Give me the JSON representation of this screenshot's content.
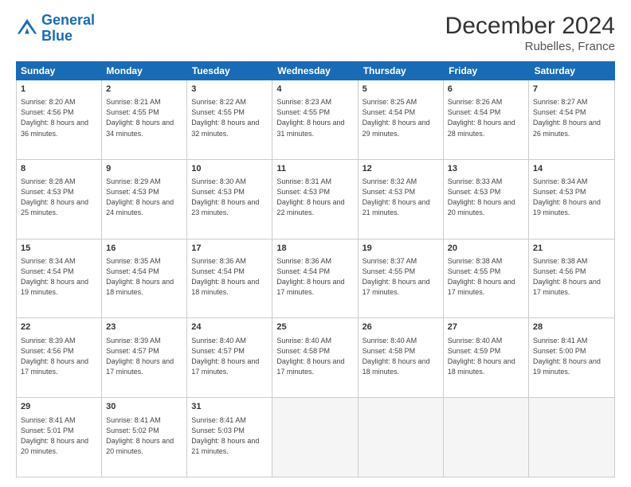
{
  "logo": {
    "line1": "General",
    "line2": "Blue"
  },
  "title": "December 2024",
  "subtitle": "Rubelles, France",
  "days": [
    "Sunday",
    "Monday",
    "Tuesday",
    "Wednesday",
    "Thursday",
    "Friday",
    "Saturday"
  ],
  "weeks": [
    [
      {
        "num": "1",
        "sunrise": "8:20 AM",
        "sunset": "4:56 PM",
        "daylight": "8 hours and 36 minutes."
      },
      {
        "num": "2",
        "sunrise": "8:21 AM",
        "sunset": "4:55 PM",
        "daylight": "8 hours and 34 minutes."
      },
      {
        "num": "3",
        "sunrise": "8:22 AM",
        "sunset": "4:55 PM",
        "daylight": "8 hours and 32 minutes."
      },
      {
        "num": "4",
        "sunrise": "8:23 AM",
        "sunset": "4:55 PM",
        "daylight": "8 hours and 31 minutes."
      },
      {
        "num": "5",
        "sunrise": "8:25 AM",
        "sunset": "4:54 PM",
        "daylight": "8 hours and 29 minutes."
      },
      {
        "num": "6",
        "sunrise": "8:26 AM",
        "sunset": "4:54 PM",
        "daylight": "8 hours and 28 minutes."
      },
      {
        "num": "7",
        "sunrise": "8:27 AM",
        "sunset": "4:54 PM",
        "daylight": "8 hours and 26 minutes."
      }
    ],
    [
      {
        "num": "8",
        "sunrise": "8:28 AM",
        "sunset": "4:53 PM",
        "daylight": "8 hours and 25 minutes."
      },
      {
        "num": "9",
        "sunrise": "8:29 AM",
        "sunset": "4:53 PM",
        "daylight": "8 hours and 24 minutes."
      },
      {
        "num": "10",
        "sunrise": "8:30 AM",
        "sunset": "4:53 PM",
        "daylight": "8 hours and 23 minutes."
      },
      {
        "num": "11",
        "sunrise": "8:31 AM",
        "sunset": "4:53 PM",
        "daylight": "8 hours and 22 minutes."
      },
      {
        "num": "12",
        "sunrise": "8:32 AM",
        "sunset": "4:53 PM",
        "daylight": "8 hours and 21 minutes."
      },
      {
        "num": "13",
        "sunrise": "8:33 AM",
        "sunset": "4:53 PM",
        "daylight": "8 hours and 20 minutes."
      },
      {
        "num": "14",
        "sunrise": "8:34 AM",
        "sunset": "4:53 PM",
        "daylight": "8 hours and 19 minutes."
      }
    ],
    [
      {
        "num": "15",
        "sunrise": "8:34 AM",
        "sunset": "4:54 PM",
        "daylight": "8 hours and 19 minutes."
      },
      {
        "num": "16",
        "sunrise": "8:35 AM",
        "sunset": "4:54 PM",
        "daylight": "8 hours and 18 minutes."
      },
      {
        "num": "17",
        "sunrise": "8:36 AM",
        "sunset": "4:54 PM",
        "daylight": "8 hours and 18 minutes."
      },
      {
        "num": "18",
        "sunrise": "8:36 AM",
        "sunset": "4:54 PM",
        "daylight": "8 hours and 17 minutes."
      },
      {
        "num": "19",
        "sunrise": "8:37 AM",
        "sunset": "4:55 PM",
        "daylight": "8 hours and 17 minutes."
      },
      {
        "num": "20",
        "sunrise": "8:38 AM",
        "sunset": "4:55 PM",
        "daylight": "8 hours and 17 minutes."
      },
      {
        "num": "21",
        "sunrise": "8:38 AM",
        "sunset": "4:56 PM",
        "daylight": "8 hours and 17 minutes."
      }
    ],
    [
      {
        "num": "22",
        "sunrise": "8:39 AM",
        "sunset": "4:56 PM",
        "daylight": "8 hours and 17 minutes."
      },
      {
        "num": "23",
        "sunrise": "8:39 AM",
        "sunset": "4:57 PM",
        "daylight": "8 hours and 17 minutes."
      },
      {
        "num": "24",
        "sunrise": "8:40 AM",
        "sunset": "4:57 PM",
        "daylight": "8 hours and 17 minutes."
      },
      {
        "num": "25",
        "sunrise": "8:40 AM",
        "sunset": "4:58 PM",
        "daylight": "8 hours and 17 minutes."
      },
      {
        "num": "26",
        "sunrise": "8:40 AM",
        "sunset": "4:58 PM",
        "daylight": "8 hours and 18 minutes."
      },
      {
        "num": "27",
        "sunrise": "8:40 AM",
        "sunset": "4:59 PM",
        "daylight": "8 hours and 18 minutes."
      },
      {
        "num": "28",
        "sunrise": "8:41 AM",
        "sunset": "5:00 PM",
        "daylight": "8 hours and 19 minutes."
      }
    ],
    [
      {
        "num": "29",
        "sunrise": "8:41 AM",
        "sunset": "5:01 PM",
        "daylight": "8 hours and 20 minutes."
      },
      {
        "num": "30",
        "sunrise": "8:41 AM",
        "sunset": "5:02 PM",
        "daylight": "8 hours and 20 minutes."
      },
      {
        "num": "31",
        "sunrise": "8:41 AM",
        "sunset": "5:03 PM",
        "daylight": "8 hours and 21 minutes."
      },
      null,
      null,
      null,
      null
    ]
  ]
}
